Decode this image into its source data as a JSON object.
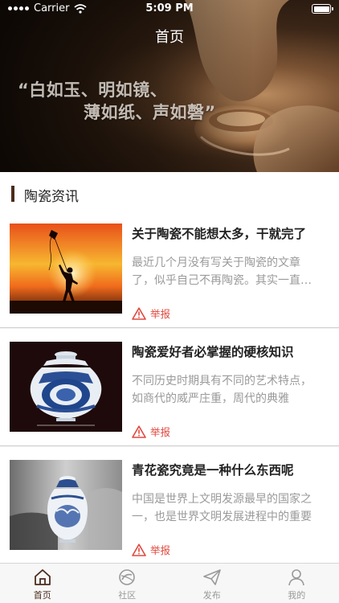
{
  "status_bar": {
    "carrier": "Carrier",
    "time": "5:09 PM"
  },
  "header": {
    "title": "首页",
    "quote_line1": "“白如玉、明如镜、",
    "quote_line2": "薄如纸、声如磬”"
  },
  "section": {
    "title": "陶瓷资讯"
  },
  "articles": [
    {
      "title": "关于陶瓷不能想太多，干就完了",
      "desc": "最近几个月没有写关于陶瓷的文章了，似乎自己不再陶瓷。其实一直都在",
      "report": "举报"
    },
    {
      "title": "陶瓷爱好者必掌握的硬核知识",
      "desc": "不同历史时期具有不同的艺术特点，如商代的威严庄重，周代的典雅",
      "report": "举报"
    },
    {
      "title": "青花瓷究竟是一种什么东西呢",
      "desc": "中国是世界上文明发源最早的国家之一，也是世界文明发展进程中的重要",
      "report": "举报"
    }
  ],
  "tabbar": {
    "items": [
      {
        "label": "首页",
        "icon": "home-icon",
        "active": true
      },
      {
        "label": "社区",
        "icon": "community-icon",
        "active": false
      },
      {
        "label": "发布",
        "icon": "publish-icon",
        "active": false
      },
      {
        "label": "我的",
        "icon": "profile-icon",
        "active": false
      }
    ]
  },
  "colors": {
    "accent": "#4a2c1d",
    "report": "#e04a3f",
    "muted_text": "#9a9a9a"
  }
}
